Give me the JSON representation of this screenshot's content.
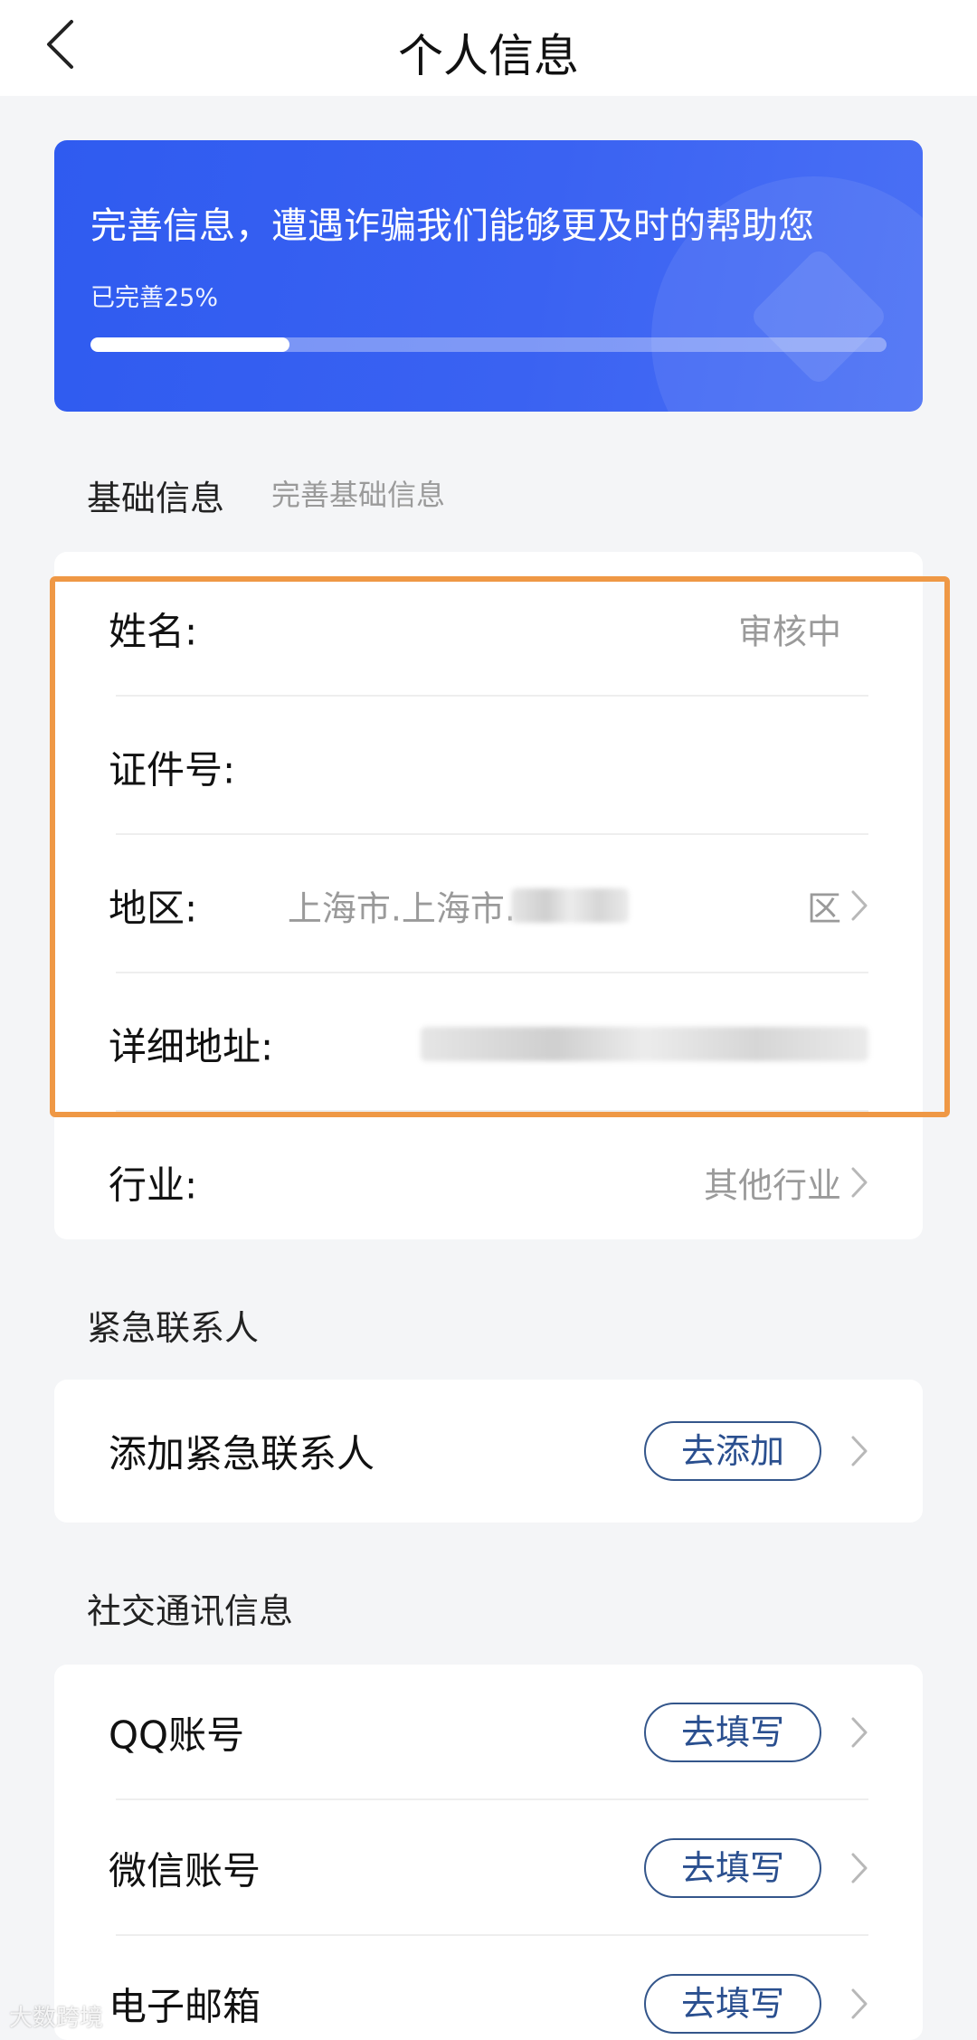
{
  "header": {
    "title": "个人信息"
  },
  "banner": {
    "headline": "完善信息，遭遇诈骗我们能够更及时的帮助您",
    "progress_text": "已完善25%",
    "progress_value": 0.25,
    "color": "#3a62f2"
  },
  "basic": {
    "title": "基础信息",
    "subtitle": "完善基础信息",
    "rows": [
      {
        "label": "姓名:",
        "value": "审核中"
      },
      {
        "label": "证件号:",
        "value": ""
      },
      {
        "label": "地区:",
        "value_prefix": "上海市.上海市.",
        "value_suffix": "区"
      },
      {
        "label": "详细地址:",
        "value": ""
      },
      {
        "label": "行业:",
        "value": "其他行业"
      }
    ]
  },
  "emergency": {
    "title": "紧急联系人",
    "rows": [
      {
        "label": "添加紧急联系人",
        "button": "去添加"
      }
    ]
  },
  "social": {
    "title": "社交通讯信息",
    "rows": [
      {
        "label": "QQ账号",
        "button": "去填写"
      },
      {
        "label": "微信账号",
        "button": "去填写"
      },
      {
        "label": "电子邮箱",
        "button": "去填写"
      }
    ]
  },
  "watermark": {
    "text": "大数跨境"
  },
  "colors": {
    "highlight": "#ef9845",
    "pill_border": "#34568b"
  }
}
